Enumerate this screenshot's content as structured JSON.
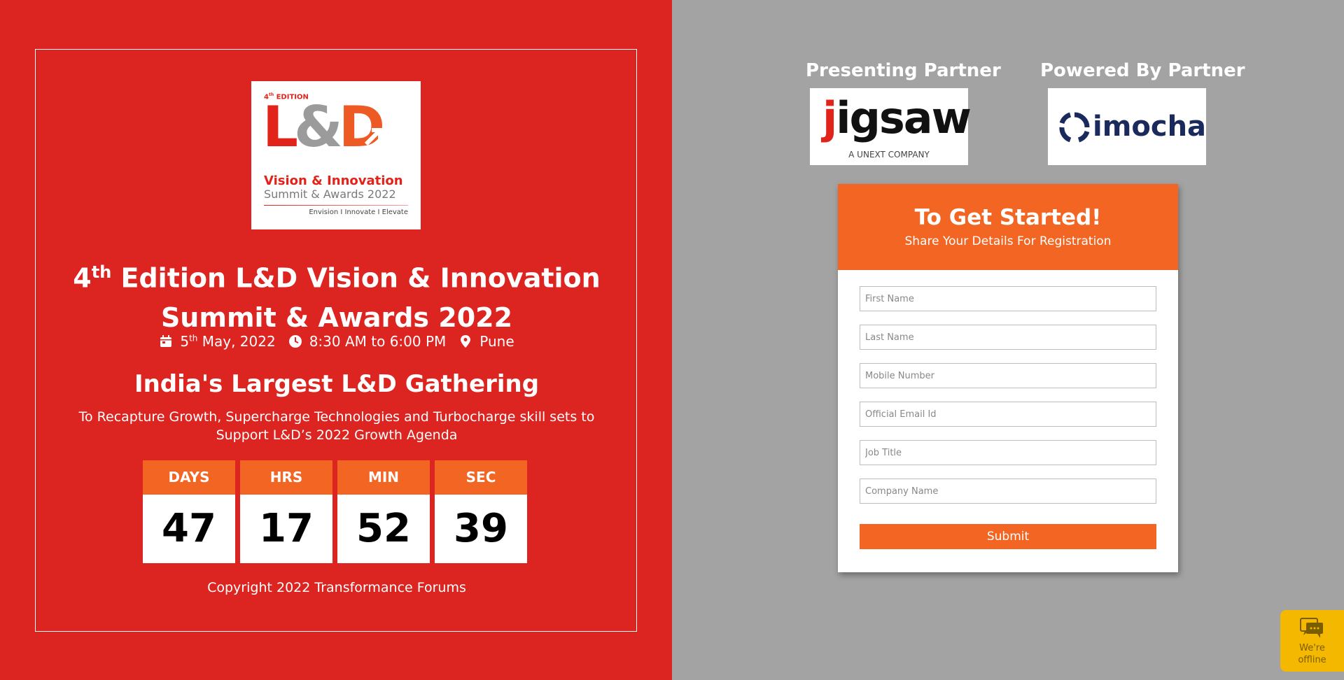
{
  "logo": {
    "edition": "4",
    "edition_suffix": "th",
    "edition_label": " EDITION",
    "ld_l": "L",
    "ld_amp": "&",
    "ld_d": "D",
    "vision": "Vision & Innovation",
    "summit": "Summit & Awards 2022",
    "tagline": "Envision I Innovate I Elevate"
  },
  "event": {
    "title_num": "4",
    "title_sup": "th",
    "title_line1_rest": " Edition L&D Vision & Innovation",
    "title_line2": "Summit & Awards 2022",
    "date_day": "5",
    "date_sup": "th",
    "date_rest": " May, 2022",
    "time": "8:30 AM to 6:00 PM",
    "location": "Pune",
    "tagline": "India's Largest L&D Gathering",
    "subtext": "To Recapture Growth, Supercharge Technologies and Turbocharge skill sets to Support L&D’s 2022 Growth Agenda",
    "copyright": "Copyright 2022 Transformance Forums"
  },
  "countdown": [
    {
      "label": "DAYS",
      "value": "47"
    },
    {
      "label": "HRS",
      "value": "17"
    },
    {
      "label": "MIN",
      "value": "52"
    },
    {
      "label": "SEC",
      "value": "39"
    }
  ],
  "partners": {
    "presenting_label": "Presenting Partner",
    "presenting_name": "igsaw",
    "presenting_initial": "j",
    "presenting_sub": "A UNEXT COMPANY",
    "powered_label": "Powered By Partner",
    "powered_name": "imocha"
  },
  "form": {
    "title": "To Get Started!",
    "subtitle": "Share Your Details For Registration",
    "fields": [
      {
        "placeholder": "First Name"
      },
      {
        "placeholder": "Last Name"
      },
      {
        "placeholder": "Mobile Number"
      },
      {
        "placeholder": "Official Email Id"
      },
      {
        "placeholder": "Job Title"
      },
      {
        "placeholder": "Company Name"
      }
    ],
    "submit_label": "Submit"
  },
  "chat": {
    "line1": "We're",
    "line2": "offline"
  },
  "colors": {
    "left_bg": "#dc2420",
    "right_bg": "#a3a3a3",
    "accent_orange": "#f26522",
    "chat_yellow": "#f5b800"
  }
}
